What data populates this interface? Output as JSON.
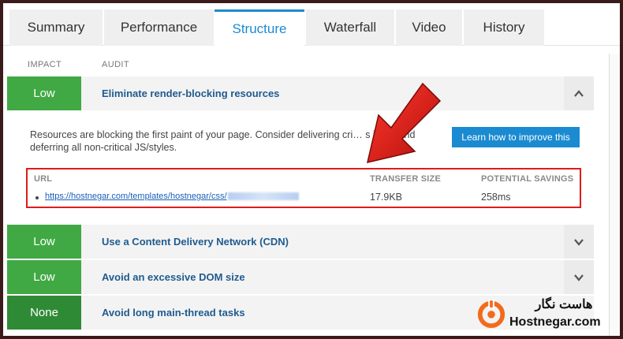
{
  "tabs": [
    {
      "label": "Summary",
      "active": false
    },
    {
      "label": "Performance",
      "active": false
    },
    {
      "label": "Structure",
      "active": true
    },
    {
      "label": "Waterfall",
      "active": false
    },
    {
      "label": "Video",
      "active": false
    },
    {
      "label": "History",
      "active": false
    }
  ],
  "columns": {
    "impact": "IMPACT",
    "audit": "AUDIT"
  },
  "audits": [
    {
      "impact": "Low",
      "title": "Eliminate render-blocking resources",
      "expanded": true
    },
    {
      "impact": "Low",
      "title": "Use a Content Delivery Network (CDN)",
      "expanded": false
    },
    {
      "impact": "Low",
      "title": "Avoid an excessive DOM size",
      "expanded": false
    },
    {
      "impact": "None",
      "title": "Avoid long main-thread tasks",
      "expanded": false
    }
  ],
  "detail": {
    "description": "Resources are blocking the first paint of your page. Consider delivering cri…                s inline and deferring all non-critical JS/styles.",
    "learn_button": "Learn how to improve this",
    "table": {
      "headers": {
        "url": "URL",
        "transfer_size": "TRANSFER SIZE",
        "potential_savings": "POTENTIAL SAVINGS"
      },
      "rows": [
        {
          "url": "https://hostnegar.com/templates/hostnegar/css/",
          "transfer_size": "17.9KB",
          "potential_savings": "258ms"
        }
      ]
    }
  },
  "logo": {
    "fa": "هاست نگار",
    "en": "Hostnegar.com"
  },
  "colors": {
    "accent": "#1b8bd1",
    "low": "#40a944",
    "none": "#2f8a36",
    "highlight": "#e01b1b",
    "logo_orange": "#f26b1d"
  },
  "icons": {
    "expanded": "chevron-up-icon",
    "collapsed": "chevron-down-icon",
    "annotation": "red-arrow-icon"
  }
}
